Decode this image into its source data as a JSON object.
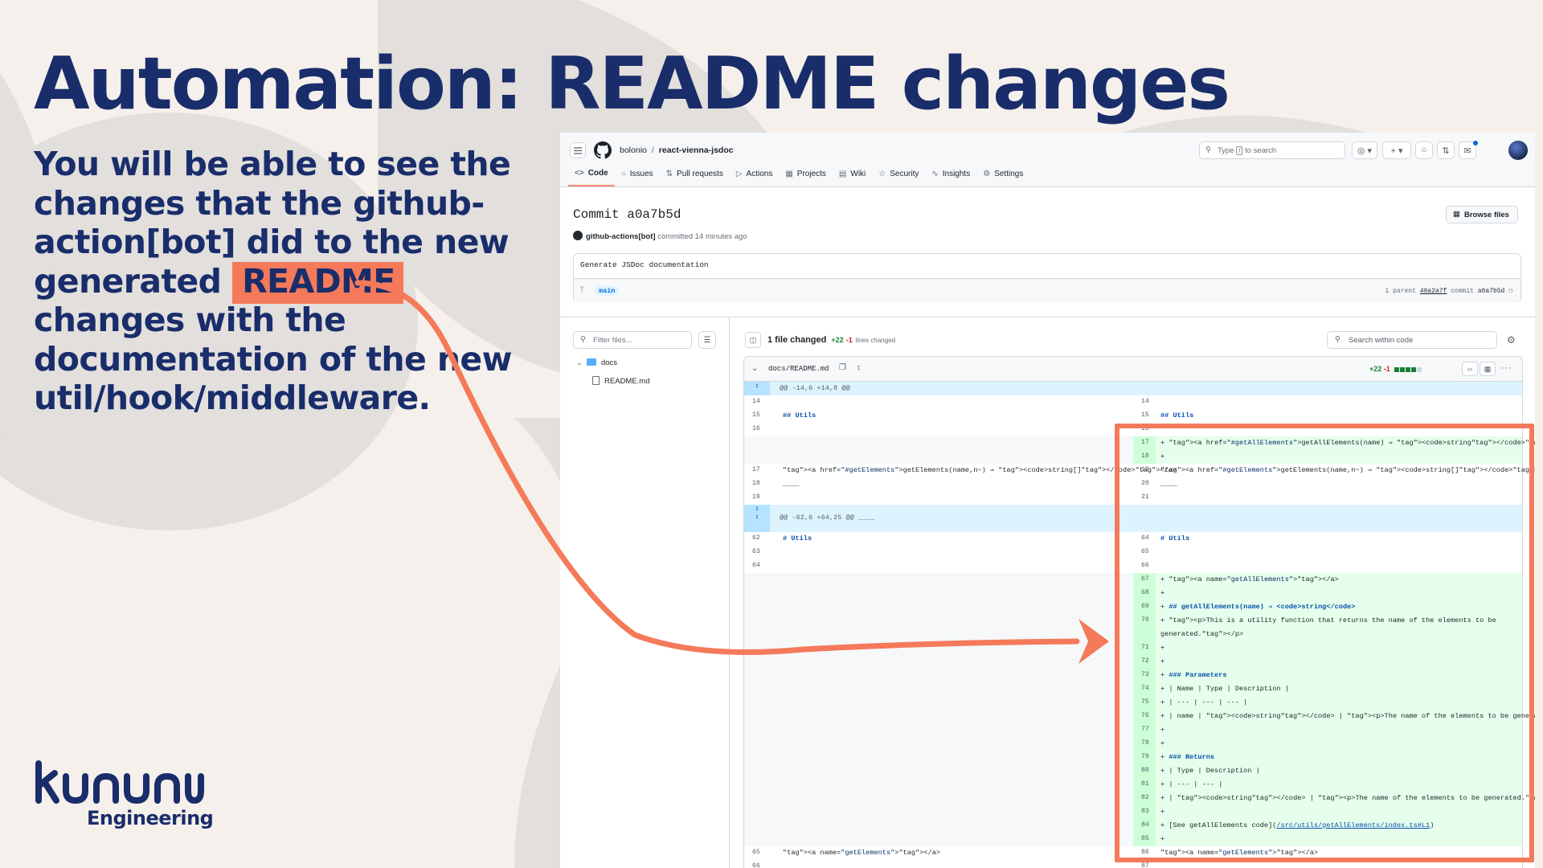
{
  "slide": {
    "title": "Automation: README changes",
    "body_before": "You will be able to see the changes that the github-action[bot] did to the new generated ",
    "body_highlight": "README",
    "body_after": " changes with the documentation of the new util/hook/middleware.",
    "brand_name": "kununu",
    "brand_sub": "Engineering",
    "accent_color": "#f47a5a",
    "text_color": "#1a2d6b"
  },
  "github": {
    "owner": "bolonio",
    "repo": "react-vienna-jsdoc",
    "search_placeholder_before": "Type",
    "search_kbd": "/",
    "search_placeholder_after": "to search",
    "tabs": [
      "Code",
      "Issues",
      "Pull requests",
      "Actions",
      "Projects",
      "Wiki",
      "Security",
      "Insights",
      "Settings"
    ],
    "tab_icons": [
      "code-icon",
      "issue-icon",
      "pull-request-icon",
      "play-icon",
      "table-icon",
      "book-icon",
      "shield-icon",
      "graph-icon",
      "gear-icon"
    ],
    "commit_title": "Commit a0a7b5d",
    "browse_files": "Browse files",
    "author": "github-actions[bot]",
    "committed": "committed 14 minutes ago",
    "message": "Generate JSDoc documentation",
    "branch": "main",
    "parent_label": "1 parent",
    "parent_hash": "49a2a7f",
    "commit_label": "commit",
    "commit_hash": "a0a7b5d",
    "filter_placeholder": "Filter files...",
    "folder": "docs",
    "file": "README.md",
    "files_changed": "1 file changed",
    "additions": "+22",
    "deletions": "-1",
    "lines_changed": "lines changed",
    "code_search": "Search within code",
    "file_path": "docs/README.md"
  },
  "diff": {
    "hunks": [
      "@@ -14,6 +14,8 @@",
      "@@ -62,6 +64,25 @@ ____"
    ],
    "left": [
      {
        "n": "14",
        "t": ""
      },
      {
        "n": "15",
        "t": "## Utils"
      },
      {
        "n": "16",
        "t": ""
      },
      {
        "n": "17",
        "t": "<a href=\"#getElements\">getElements(name,n~) ⇒ <code>string[]</code></a>"
      },
      {
        "n": "18",
        "t": "____"
      },
      {
        "n": "19",
        "t": ""
      },
      {
        "n": "62",
        "t": "# Utils"
      },
      {
        "n": "63",
        "t": ""
      },
      {
        "n": "64",
        "t": ""
      },
      {
        "n": "65",
        "t": "<a name=\"getElements\"></a>"
      },
      {
        "n": "66",
        "t": ""
      }
    ],
    "right": [
      {
        "n": "14",
        "t": ""
      },
      {
        "n": "15",
        "t": "## Utils"
      },
      {
        "n": "16",
        "t": ""
      },
      {
        "n": "17",
        "t": "+ <a href=\"#getAllElements\">getAllElements(name) ⇒ <code>string</code></a>"
      },
      {
        "n": "18",
        "t": "+"
      },
      {
        "n": "19",
        "t": "<a href=\"#getElements\">getElements(name,n~) ⇒ <code>string[]</code></a>"
      },
      {
        "n": "20",
        "t": "____"
      },
      {
        "n": "21",
        "t": ""
      },
      {
        "n": "64",
        "t": "# Utils"
      },
      {
        "n": "65",
        "t": ""
      },
      {
        "n": "66",
        "t": ""
      },
      {
        "n": "67",
        "t": "+ <a name=\"getAllElements\"></a>"
      },
      {
        "n": "68",
        "t": "+"
      },
      {
        "n": "69",
        "t": "+ ## getAllElements(name) ⇒ <code>string</code>"
      },
      {
        "n": "70",
        "t": "+ <p>This is a utility function that returns the name of the elements to be"
      },
      {
        "n": "",
        "t": "generated.</p>"
      },
      {
        "n": "71",
        "t": "+"
      },
      {
        "n": "72",
        "t": "+"
      },
      {
        "n": "73",
        "t": "+ ### Parameters"
      },
      {
        "n": "74",
        "t": "+ | Name | Type | Description |"
      },
      {
        "n": "75",
        "t": "+ | --- | --- | --- |"
      },
      {
        "n": "76",
        "t": "+ | name | <code>string</code> | <p>The name of the elements to be generated.</p> |"
      },
      {
        "n": "77",
        "t": "+"
      },
      {
        "n": "78",
        "t": "+"
      },
      {
        "n": "79",
        "t": "+ ### Returns"
      },
      {
        "n": "80",
        "t": "+ |  Type | Description |"
      },
      {
        "n": "81",
        "t": "+ |  --- | --- |"
      },
      {
        "n": "82",
        "t": "+ |  <code>string</code> | <p>The name of the elements to be generated.</p> |"
      },
      {
        "n": "83",
        "t": "+"
      },
      {
        "n": "84",
        "t": "+ [See getAllElements code](/src/utils/getAllElements/index.ts#L1)"
      },
      {
        "n": "85",
        "t": "+"
      },
      {
        "n": "86",
        "t": "<a name=\"getElements\"></a>"
      },
      {
        "n": "87",
        "t": ""
      }
    ]
  }
}
